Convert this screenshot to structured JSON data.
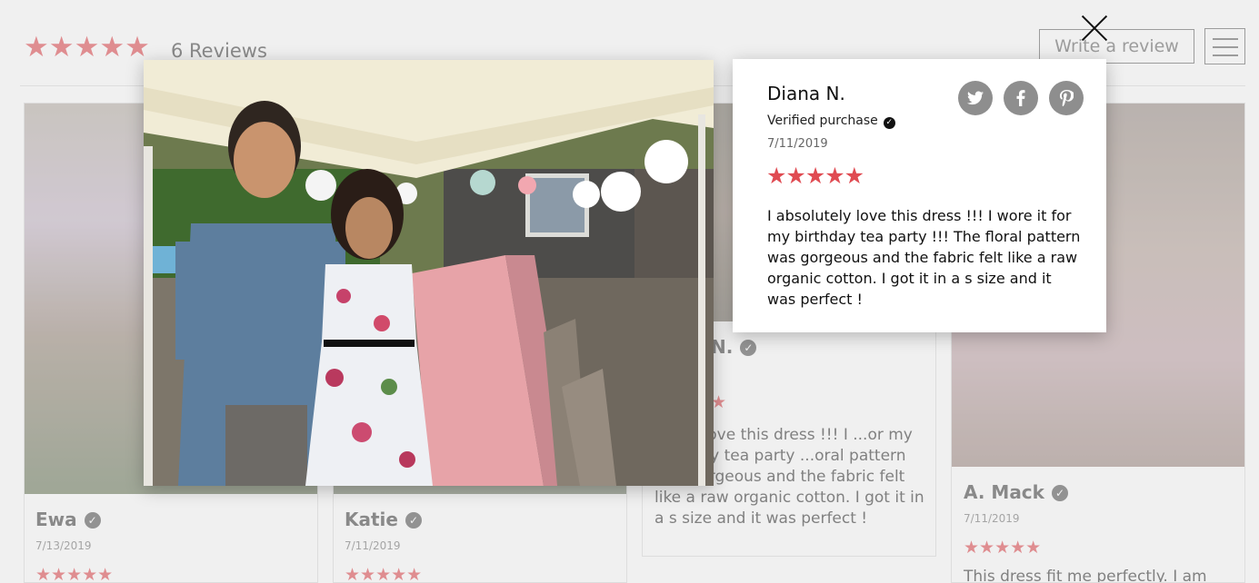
{
  "background": {
    "rating_stars": "★★★★★",
    "reviews_count": "6 Reviews",
    "write_review_label": "Write a review",
    "cards": [
      {
        "name": "Ewa",
        "date": "7/13/2019",
        "stars": "★★★★★",
        "text": ""
      },
      {
        "name": "Katie",
        "date": "7/11/2019",
        "stars": "★★★★★",
        "text": ""
      },
      {
        "name": "N.",
        "date": "",
        "stars": "★",
        "text": "...tely love this dress !!! I ...or my birthday tea party ...oral pattern was gorgeous and the fabric felt like a raw organic cotton. I got it in a s size and it was perfect !"
      },
      {
        "name": "A. Mack",
        "date": "7/11/2019",
        "stars": "★★★★★",
        "text": "This dress fit me perfectly. I am"
      }
    ]
  },
  "modal": {
    "reviewer_name": "Diana N.",
    "verified_label": "Verified purchase",
    "date": "7/11/2019",
    "stars": "★★★★★",
    "rating": 5,
    "review_text": "I absolutely love this dress !!! I wore it for my birthday tea party !!! The floral pattern was gorgeous and the fabric felt like a raw organic cotton. I got it in a s size and it was perfect !",
    "share": {
      "twitter_icon": "twitter-icon",
      "facebook_icon": "facebook-icon",
      "pinterest_icon": "pinterest-icon"
    },
    "colors": {
      "star": "#e04b52",
      "share_bg": "#8e8e8e"
    }
  }
}
